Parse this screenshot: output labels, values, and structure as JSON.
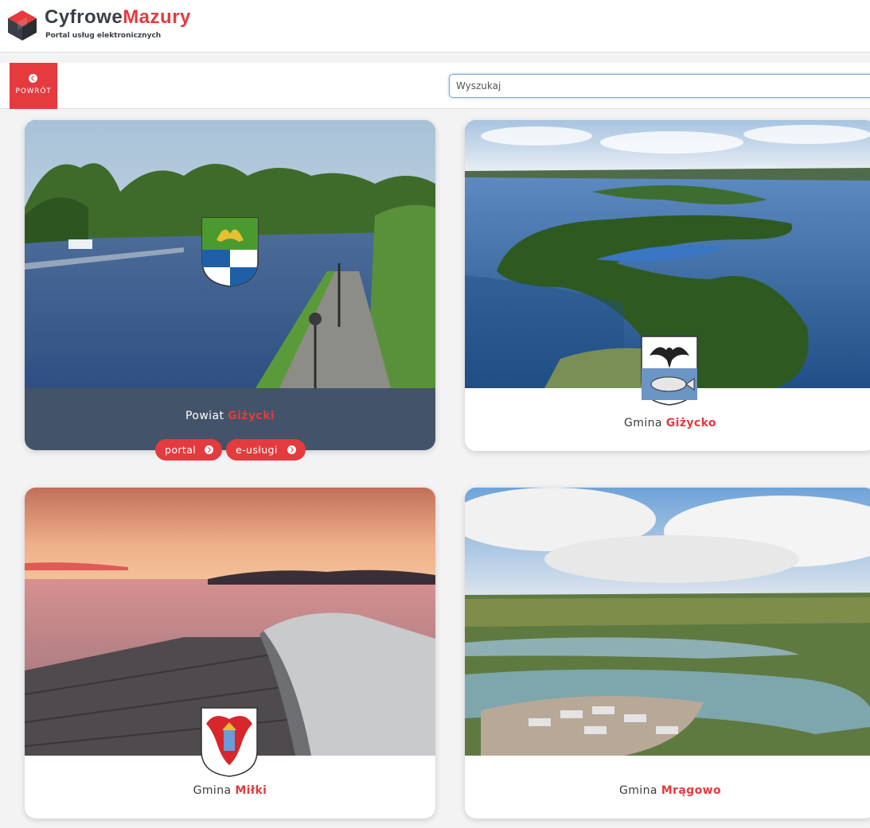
{
  "header": {
    "brand_dark": "Cyfrowe",
    "brand_accent": "Mazury",
    "subtitle": "Portal usług elektronicznych"
  },
  "toolbar": {
    "back_label": "POWRÓT",
    "search_placeholder": "Wyszukaj",
    "search_value": ""
  },
  "cards": [
    {
      "prefix": "Powiat",
      "name": "Giżycki",
      "buttons": [
        "portal",
        "e-usługi"
      ]
    },
    {
      "prefix": "Gmina",
      "name": "Giżycko"
    },
    {
      "prefix": "Gmina",
      "name": "Miłki"
    },
    {
      "prefix": "Gmina",
      "name": "Mrągowo"
    }
  ],
  "colors": {
    "accent": "#e53a3e",
    "dark_card": "#435369"
  },
  "icons": [
    "logo-icon",
    "back-arrow-icon",
    "chevron-right-icon"
  ]
}
